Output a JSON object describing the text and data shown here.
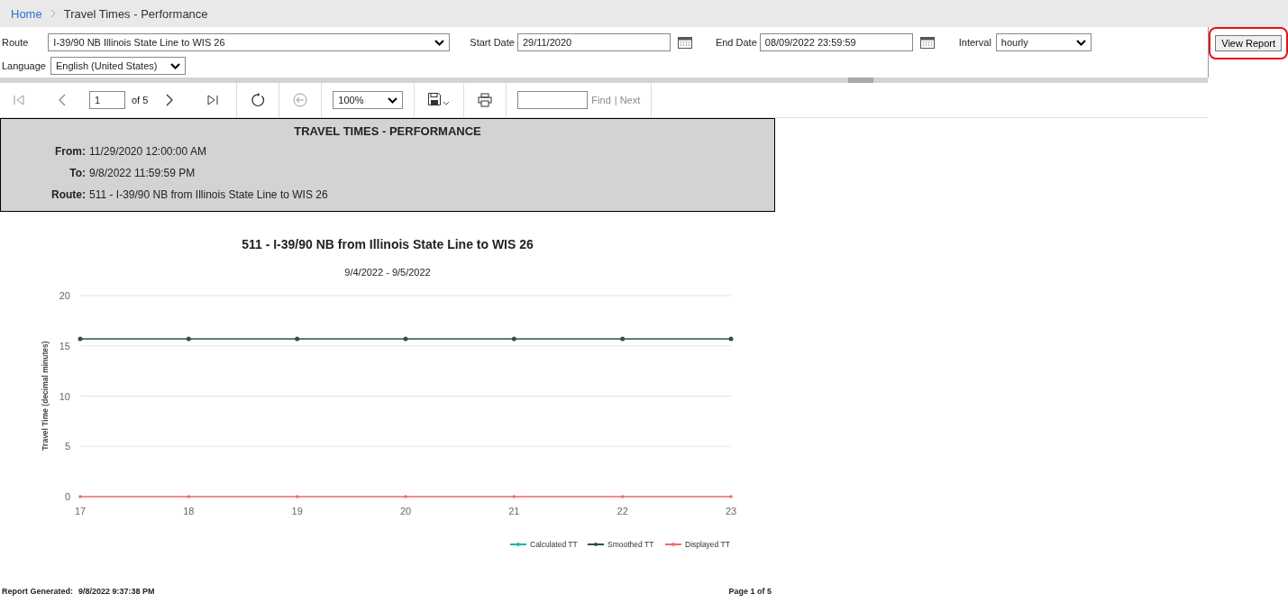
{
  "breadcrumb": {
    "home": "Home",
    "current": "Travel Times - Performance"
  },
  "params": {
    "route": {
      "label": "Route",
      "value": "I-39/90 NB Illinois State Line to WIS 26"
    },
    "start_date": {
      "label": "Start Date",
      "value": "29/11/2020"
    },
    "end_date": {
      "label": "End Date",
      "value": "08/09/2022 23:59:59"
    },
    "interval": {
      "label": "Interval",
      "value": "hourly"
    },
    "language": {
      "label": "Language",
      "value": "English (United States)"
    },
    "view_report": {
      "label": "View Report",
      "highlighted": true
    }
  },
  "toolbar": {
    "page": "1",
    "page_count": "of 5",
    "zoom": "100%",
    "find_link": "Find",
    "next_link": "| Next"
  },
  "report": {
    "title": "TRAVEL TIMES - PERFORMANCE",
    "fields": [
      {
        "label": "From:",
        "value": "11/29/2020 12:00:00 AM"
      },
      {
        "label": "To:",
        "value": "9/8/2022 11:59:59 PM"
      },
      {
        "label": "Route:",
        "value": "511 - I-39/90 NB from Illinois State Line to WIS 26"
      }
    ],
    "chart_title": "511 - I-39/90 NB from Illinois State Line to WIS 26",
    "chart_subtitle": "9/4/2022 - 9/5/2022",
    "chart_data": {
      "type": "line",
      "ylabel": "Travel Time (decimal minutes)",
      "x": [
        "17",
        "18",
        "19",
        "20",
        "21",
        "22",
        "23"
      ],
      "ylim": [
        0,
        20
      ],
      "yticks": [
        0,
        5,
        10,
        15,
        20
      ],
      "grid": true,
      "legend": true,
      "series": [
        {
          "name": "Calculated TT",
          "color": "#1fb5a8",
          "values": [
            null,
            null,
            null,
            null,
            null,
            null,
            null
          ]
        },
        {
          "name": "Smoothed TT",
          "color": "#2f4f4f",
          "values": [
            15.7,
            15.7,
            15.7,
            15.7,
            15.7,
            15.7,
            15.7
          ]
        },
        {
          "name": "Displayed TT",
          "color": "#f26b6b",
          "values": [
            0,
            0,
            0,
            0,
            0,
            0,
            0
          ]
        }
      ]
    },
    "footer_label": "Report Generated:",
    "footer_value": "9/8/2022 9:37:38 PM",
    "page_info": "Page 1 of 5"
  }
}
